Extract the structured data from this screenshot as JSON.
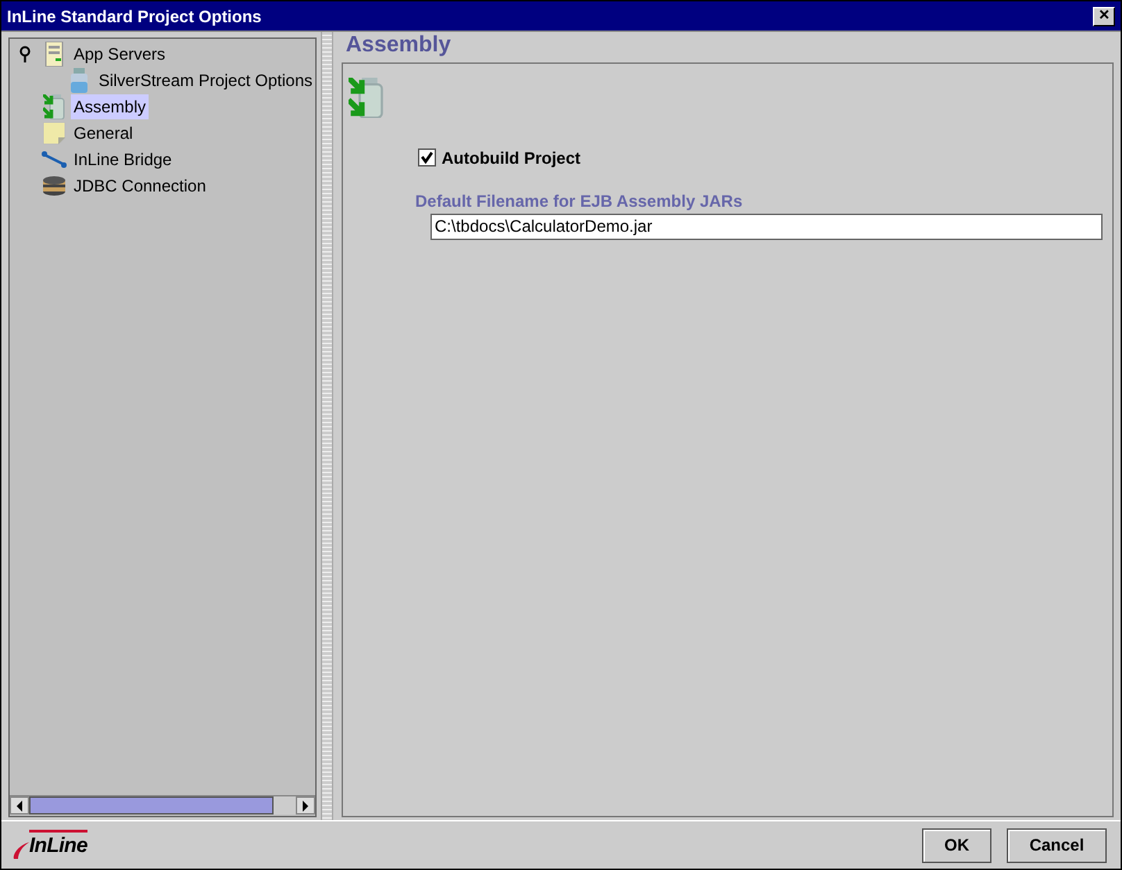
{
  "window": {
    "title": "InLine Standard Project Options",
    "close": "✕"
  },
  "tree": [
    {
      "label": "App Servers",
      "kind": "server",
      "selected": false,
      "expanded": true,
      "children": [
        {
          "label": "SilverStream Project Options",
          "kind": "jar",
          "selected": false
        }
      ]
    },
    {
      "label": "Assembly",
      "kind": "assembly",
      "selected": true
    },
    {
      "label": "General",
      "kind": "note",
      "selected": false
    },
    {
      "label": "InLine Bridge",
      "kind": "bridge",
      "selected": false
    },
    {
      "label": "JDBC Connection",
      "kind": "database",
      "selected": false
    }
  ],
  "panel": {
    "title": "Assembly",
    "autobuild": {
      "label": "Autobuild Project",
      "checked": true
    },
    "filename": {
      "label": "Default Filename for EJB Assembly JARs",
      "value": "C:\\tbdocs\\CalculatorDemo.jar"
    }
  },
  "logo": "InLine",
  "buttons": [
    "OK",
    "Cancel"
  ]
}
